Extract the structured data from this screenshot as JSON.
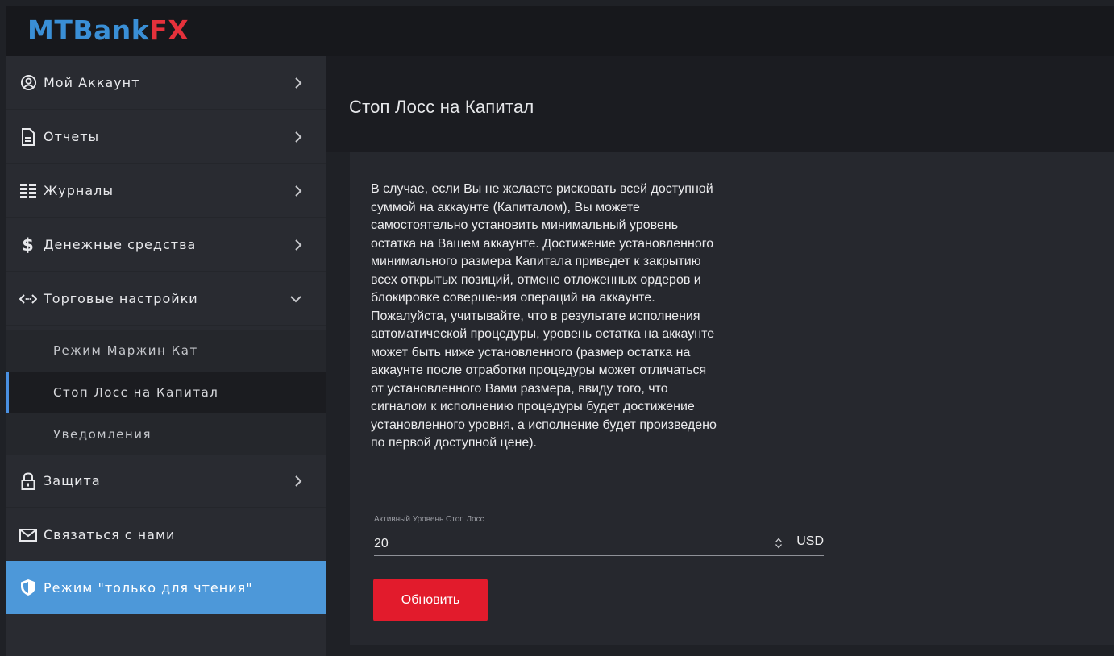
{
  "brand": {
    "part1": "MTBank",
    "part2": "F",
    "part3": "X"
  },
  "sidebar": {
    "items": [
      {
        "label": "Мой Аккаунт"
      },
      {
        "label": "Отчеты"
      },
      {
        "label": "Журналы"
      },
      {
        "label": "Денежные средства"
      },
      {
        "label": "Торговые настройки"
      }
    ],
    "subitems": [
      {
        "label": "Режим Маржин Кат"
      },
      {
        "label": "Стоп Лосс на Капитал"
      },
      {
        "label": "Уведомления"
      }
    ],
    "items_after": [
      {
        "label": "Защита"
      },
      {
        "label": "Связаться с нами"
      },
      {
        "label": "Режим \"только для чтения\""
      }
    ]
  },
  "main": {
    "title": "Стоп Лосс на Капитал",
    "description_lines": [
      "В случае, если Вы не желаете рисковать всей доступной",
      "суммой на аккаунте (Капиталом), Вы можете",
      "самостоятельно установить минимальный уровень",
      "остатка на Вашем аккаунте. Достижение установленного",
      "минимального размера Капитала приведет к закрытию",
      "всех открытых позиций, отмене отложенных ордеров и",
      "блокировке совершения операций на аккаунте.",
      "Пожалуйста, учитывайте, что в результате исполнения",
      "автоматической процедуры, уровень остатка на аккаунте",
      "может быть ниже установленного (размер остатка на",
      "аккаунте после отработки процедуры может отличаться",
      "от установленного Вами размера, ввиду того, что",
      "сигналом к исполнению процедуры будет достижение",
      "установленного уровня, а исполнение будет произведено",
      "по первой доступной цене)."
    ],
    "field_label": "Активный Уровень Стоп Лосс",
    "field_value": "20",
    "currency": "USD",
    "update_label": "Обновить"
  },
  "colors": {
    "accent_blue": "#4d98d9",
    "button_red": "#e21b2c",
    "logo_blue": "#3a8fd6",
    "logo_red": "#e5313b"
  }
}
